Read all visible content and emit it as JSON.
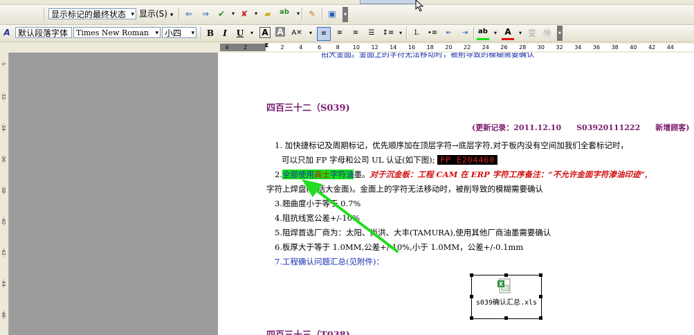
{
  "toolbar_review": {
    "display_mode": "显示标记的最终状态",
    "show_label": "显示(S)",
    "show_shortcut": "S"
  },
  "toolbar_format": {
    "style": "默认段落字体",
    "font": "Times New Roman",
    "size": "小四"
  },
  "ruler": {
    "numbers": [
      "4",
      "2",
      "",
      "2",
      "4",
      "6",
      "8",
      "10",
      "12",
      "14",
      "16",
      "18",
      "20",
      "22",
      "24",
      "26",
      "28",
      "30",
      "32",
      "34",
      "36",
      "38",
      "40",
      "42",
      "44"
    ]
  },
  "document": {
    "top_cutoff": "拍大金面。金面上的字符无法移动时，被削导致的模糊需要确认",
    "section_title": "四百三十二（S039)",
    "update_record": "(更新记录：2011.12.10　　S03920111222　　新增顾客)",
    "item1_line1": "1. 加快捷标记及周期标记，优先顺序加在顶层字符→底层字符,对于板内没有空间加我们全套标记时，",
    "item1_line2": "可以只加 FP 字母和公司 UL 认证(如下图);",
    "ul_mark": "FP E204460",
    "item2_prefix": "2.",
    "item2_hl1": "全部使用",
    "item2_hl_red": "高士",
    "item2_hl2": "字符油",
    "item2_rest": "墨。",
    "item2_red": "对于沉金板：工程 CAM 在 ERP 字符工序备注：“不允许金面字符渗油印迹”,",
    "item2_cont": "字符上焊盘(包括大金面)。金面上的字符无法移动时，被削导致的模糊需要确认",
    "item3": "3.翘曲度小于等于 0.7%",
    "item4": "4.阻抗线宽公差+/-10%",
    "item5": "5.阻焊首选厂商为：太阳、尚洪、大丰(TAMURA),使用其他厂商油墨需要确认",
    "item6": "6.板厚大于等于 1.0MM,公差+/-10%,小于 1.0MM，公差+/-0.1mm",
    "item7": "7.工程确认问题汇总(见附件)：",
    "attachment_name": "s039确认汇总.xls",
    "next_section_cutoff": "四百三十三（T038)"
  },
  "colors": {
    "section_title": "#7b1a6e",
    "blue_text": "#1a2fb0",
    "red_text": "#d01010",
    "highlight": "#14e014",
    "arrow": "#22dd22"
  }
}
